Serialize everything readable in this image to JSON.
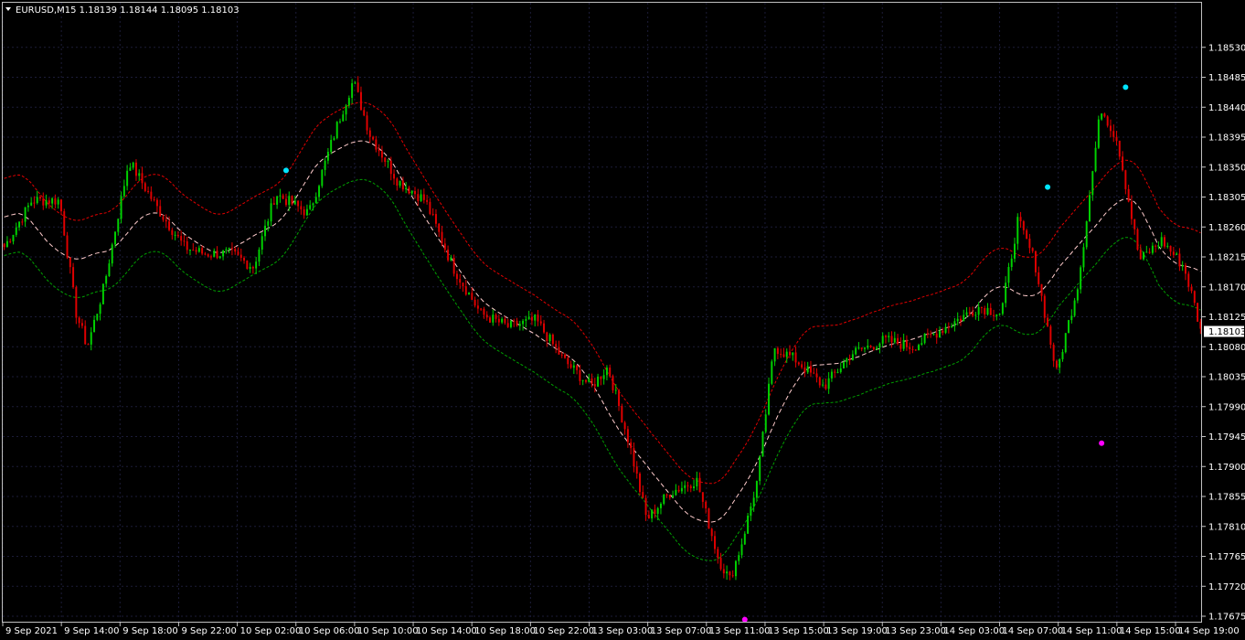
{
  "header": {
    "symbol_line": "EURUSD,M15  1.18139 1.18144 1.18095 1.18103"
  },
  "colors": {
    "background": "#000000",
    "frame": "#c0c0c0",
    "grid": "#1c1c38",
    "bull_candle": "#00d200",
    "bear_candle": "#e00000",
    "ma_line": "#ffcccc",
    "upper_band": "#e00000",
    "lower_band": "#00a000",
    "peak_marker": "#00e5ff",
    "trough_marker": "#ff00ff",
    "text": "#ffffff"
  },
  "chart_data": {
    "type": "candlestick",
    "symbol": "EURUSD",
    "timeframe": "M15",
    "ylim": [
      1.17675,
      1.18575
    ],
    "y_ticks": [
      "1.18530",
      "1.18485",
      "1.18440",
      "1.18395",
      "1.18350",
      "1.18305",
      "1.18260",
      "1.18215",
      "1.18170",
      "1.18125",
      "1.18080",
      "1.18035",
      "1.17990",
      "1.17945",
      "1.17900",
      "1.17855",
      "1.17810",
      "1.17765",
      "1.17720",
      "1.17675"
    ],
    "current_price": "1.18103",
    "x_ticks": [
      "9 Sep 2021",
      "9 Sep 14:00",
      "9 Sep 18:00",
      "9 Sep 22:00",
      "10 Sep 02:00",
      "10 Sep 06:00",
      "10 Sep 10:00",
      "10 Sep 14:00",
      "10 Sep 18:00",
      "10 Sep 22:00",
      "13 Sep 03:00",
      "13 Sep 07:00",
      "13 Sep 11:00",
      "13 Sep 15:00",
      "13 Sep 19:00",
      "13 Sep 23:00",
      "14 Sep 03:00",
      "14 Sep 07:00",
      "14 Sep 11:00",
      "14 Sep 15:00",
      "14 Sep 19:00"
    ],
    "bar_count": 400,
    "price_path": [
      [
        0,
        1.1823
      ],
      [
        10,
        1.183
      ],
      [
        20,
        1.183
      ],
      [
        26,
        1.1813
      ],
      [
        30,
        1.1808
      ],
      [
        36,
        1.1817
      ],
      [
        45,
        1.1836
      ],
      [
        55,
        1.1829
      ],
      [
        65,
        1.1823
      ],
      [
        72,
        1.1822
      ],
      [
        82,
        1.1822
      ],
      [
        90,
        1.182
      ],
      [
        98,
        1.1831
      ],
      [
        110,
        1.1828
      ],
      [
        120,
        1.1841
      ],
      [
        126,
        1.1848
      ],
      [
        132,
        1.184
      ],
      [
        142,
        1.1833
      ],
      [
        152,
        1.183
      ],
      [
        162,
        1.182
      ],
      [
        172,
        1.1813
      ],
      [
        182,
        1.1811
      ],
      [
        192,
        1.1812
      ],
      [
        202,
        1.1806
      ],
      [
        212,
        1.1802
      ],
      [
        218,
        1.1805
      ],
      [
        226,
        1.1793
      ],
      [
        232,
        1.1782
      ],
      [
        240,
        1.1786
      ],
      [
        250,
        1.1788
      ],
      [
        258,
        1.1776
      ],
      [
        262,
        1.1773
      ],
      [
        266,
        1.1778
      ],
      [
        272,
        1.1788
      ],
      [
        278,
        1.1808
      ],
      [
        286,
        1.1806
      ],
      [
        296,
        1.1802
      ],
      [
        306,
        1.1807
      ],
      [
        318,
        1.1809
      ],
      [
        328,
        1.1808
      ],
      [
        340,
        1.1811
      ],
      [
        352,
        1.1814
      ],
      [
        360,
        1.1813
      ],
      [
        366,
        1.1827
      ],
      [
        372,
        1.1821
      ],
      [
        380,
        1.1804
      ],
      [
        388,
        1.1818
      ],
      [
        396,
        1.1844
      ],
      [
        402,
        1.1839
      ],
      [
        410,
        1.1821
      ],
      [
        418,
        1.1824
      ],
      [
        426,
        1.182
      ],
      [
        430,
        1.1814
      ],
      [
        432,
        1.18103
      ]
    ],
    "series": [
      {
        "name": "candles",
        "style": "candles"
      },
      {
        "name": "moving-average",
        "style": "dashed"
      },
      {
        "name": "upper-band",
        "style": "dashed"
      },
      {
        "name": "lower-band",
        "style": "dashed"
      }
    ],
    "band_offset": 0.00058,
    "markers": [
      {
        "kind": "peak",
        "bar": 102,
        "price": 1.18345
      },
      {
        "kind": "peak",
        "bar": 376,
        "price": 1.1832
      },
      {
        "kind": "peak",
        "bar": 404,
        "price": 1.1847
      },
      {
        "kind": "trough",
        "bar": 267,
        "price": 1.1767
      },
      {
        "kind": "trough",
        "bar": 395,
        "price": 1.17935
      }
    ]
  }
}
